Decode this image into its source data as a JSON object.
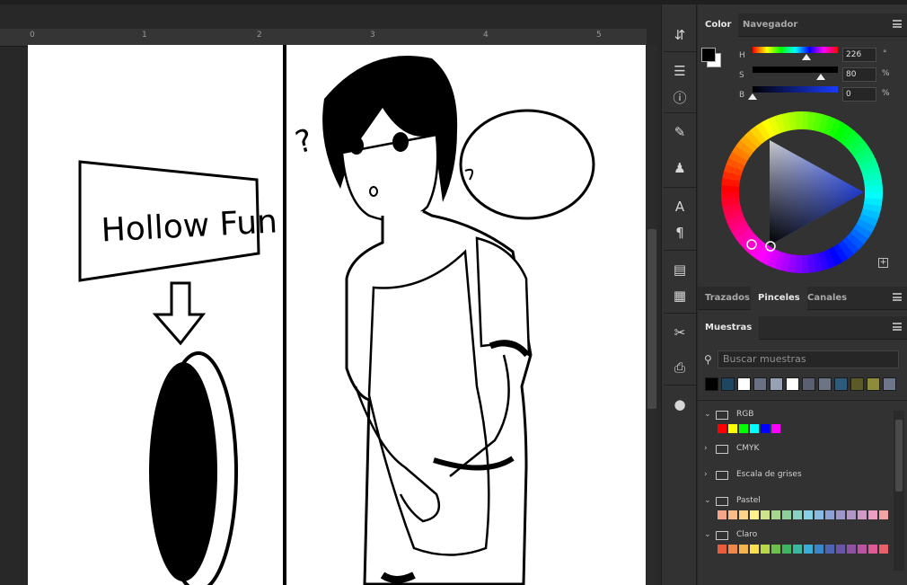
{
  "ruler": {
    "marks": [
      "0",
      "1",
      "2",
      "3",
      "4",
      "5"
    ]
  },
  "canvas": {
    "sign_text": "Hollow Fun",
    "question_mark": "?"
  },
  "toolbar": {
    "icons": [
      "history-icon",
      "adjustments-icon",
      "info-icon",
      "brush-settings-icon",
      "clone-source-icon",
      "character-icon",
      "paragraph-icon",
      "libraries-icon",
      "notes-icon",
      "tools-icon",
      "export-icon",
      "material-icon"
    ]
  },
  "color_panel": {
    "tabs": [
      "Color",
      "Navegador"
    ],
    "active_tab": "Color",
    "h_label": "H",
    "s_label": "S",
    "b_label": "B",
    "h_value": "226",
    "s_value": "80",
    "b_value": "0",
    "h_unit": "°",
    "s_unit": "%",
    "b_unit": "%",
    "foreground_color": "#000000",
    "background_color": "#ffffff",
    "h_fraction": 0.63,
    "s_fraction": 0.8,
    "b_fraction": 0.0
  },
  "brushes_panel": {
    "tabs": [
      "Trazados",
      "Pinceles",
      "Canales"
    ],
    "active_tab": "Pinceles"
  },
  "swatches_panel": {
    "tab": "Muestras",
    "search_placeholder": "Buscar muestras",
    "recent_colors": [
      "#000000",
      "#1f4660",
      "#ffffff",
      "#6b7183",
      "#96a1b4",
      "#ffffff",
      "#5b6070",
      "#6d7585",
      "#2f5b7a",
      "#5d5a2a",
      "#8d8c3a",
      "#6e778a"
    ],
    "groups": [
      {
        "name": "RGB",
        "expanded": true,
        "colors": [
          "#ff0000",
          "#ffff00",
          "#00ff00",
          "#00ffff",
          "#0000ff",
          "#ff00ff"
        ]
      },
      {
        "name": "CMYK",
        "expanded": false,
        "colors": []
      },
      {
        "name": "Escala de grises",
        "expanded": false,
        "colors": []
      },
      {
        "name": "Pastel",
        "expanded": true,
        "colors": [
          "#f4a58a",
          "#f7bc8a",
          "#fbd38b",
          "#fdf18c",
          "#cde38c",
          "#a6d58d",
          "#8bcf9c",
          "#8bd1c4",
          "#87d0e6",
          "#8ab9e2",
          "#8ea1d2",
          "#9c96c9",
          "#b197c6",
          "#cf9ac5",
          "#ec9fc2",
          "#f2a3a4"
        ]
      },
      {
        "name": "Claro",
        "expanded": true,
        "colors": [
          "#e85d3c",
          "#f0884a",
          "#f5b44d",
          "#f7e04d",
          "#b8d84b",
          "#6cc04e",
          "#3fb563",
          "#3bb8a0",
          "#3aaed6",
          "#3b86c9",
          "#4c64b2",
          "#6a54a5",
          "#8f52a2",
          "#bb54a0",
          "#e05b95",
          "#e8606a"
        ]
      }
    ]
  }
}
